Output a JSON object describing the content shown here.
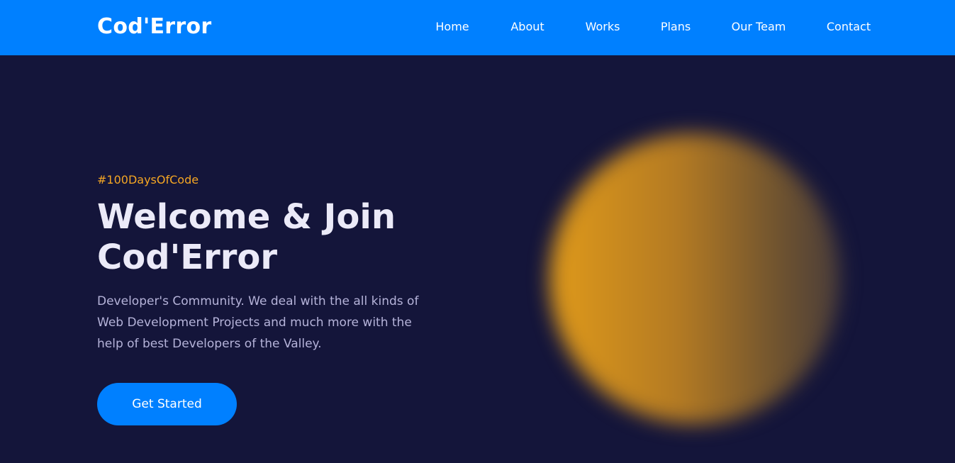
{
  "brand": {
    "name": "Cod'Error"
  },
  "nav": {
    "items": [
      {
        "label": "Home"
      },
      {
        "label": "About"
      },
      {
        "label": "Works"
      },
      {
        "label": "Plans"
      },
      {
        "label": "Our Team"
      },
      {
        "label": "Contact"
      }
    ],
    "active": "Home"
  },
  "hero": {
    "tagline": "#100DaysOfCode",
    "headline": "Welcome & Join Cod'Error",
    "description": "Developer's Community. We deal with the all kinds of Web Development Projects and much more with the help of best Developers of the Valley.",
    "cta_label": "Get Started"
  },
  "colors": {
    "primary": "#0080ff",
    "background": "#14153a",
    "accent": "#f5a623",
    "headline": "#ebeaf8",
    "body_text": "#b5b3d9"
  }
}
